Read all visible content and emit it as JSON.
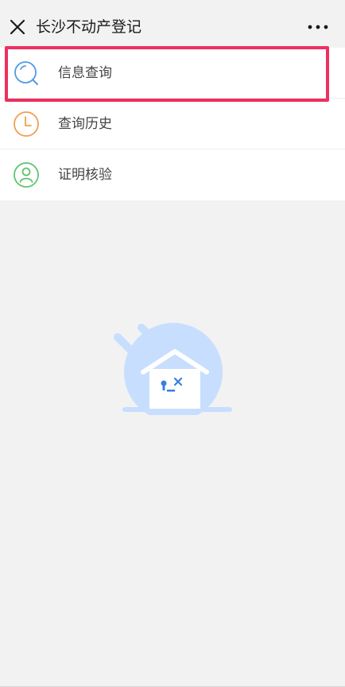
{
  "header": {
    "title": "长沙不动产登记",
    "close_icon": "close-icon",
    "more_icon": "more-dots-icon"
  },
  "menu": {
    "items": [
      {
        "label": "信息查询",
        "icon": "search-icon",
        "color": "#4f9be6",
        "highlighted": true
      },
      {
        "label": "查询历史",
        "icon": "clock-icon",
        "color": "#f0a050"
      },
      {
        "label": "证明核验",
        "icon": "user-verify-icon",
        "color": "#5fc46d"
      }
    ]
  },
  "colors": {
    "highlight_border": "#ee2f5f",
    "illustration": "#c7deff",
    "illustration_face": "#3a7de0"
  }
}
